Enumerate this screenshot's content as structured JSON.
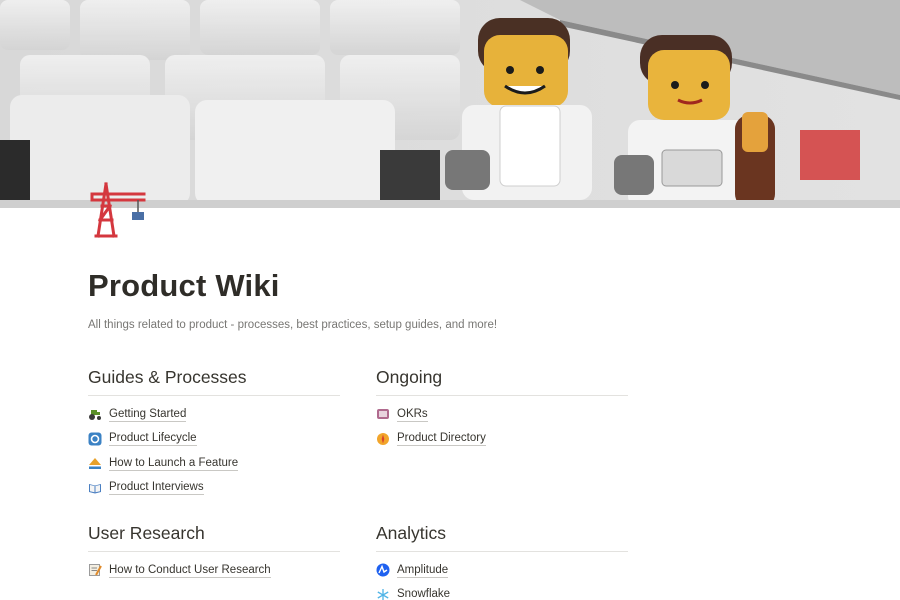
{
  "page": {
    "title": "Product Wiki",
    "subtitle": "All things related to product - processes, best practices, setup guides, and more!",
    "icon": "construction-crane-icon"
  },
  "cover": {
    "image": "lego-astronauts-on-keyboard"
  },
  "sections": [
    {
      "heading": "Guides & Processes",
      "links": [
        {
          "label": "Getting Started",
          "icon": "tractor-icon"
        },
        {
          "label": "Product Lifecycle",
          "icon": "cycle-icon"
        },
        {
          "label": "How to Launch a Feature",
          "icon": "eject-icon"
        },
        {
          "label": "Product Interviews",
          "icon": "open-book-icon"
        }
      ]
    },
    {
      "heading": "Ongoing",
      "links": [
        {
          "label": "OKRs",
          "icon": "stadium-icon"
        },
        {
          "label": "Product Directory",
          "icon": "compass-icon"
        }
      ]
    },
    {
      "heading": "User Research",
      "links": [
        {
          "label": "How to Conduct User Research",
          "icon": "memo-icon"
        }
      ]
    },
    {
      "heading": "Analytics",
      "links": [
        {
          "label": "Amplitude",
          "icon": "amplitude-icon"
        },
        {
          "label": "Snowflake",
          "icon": "snowflake-icon"
        }
      ]
    }
  ],
  "colors": {
    "text": "#37352f",
    "muted": "#787774",
    "divider": "#e3e2df",
    "crane": "#d4373e"
  }
}
